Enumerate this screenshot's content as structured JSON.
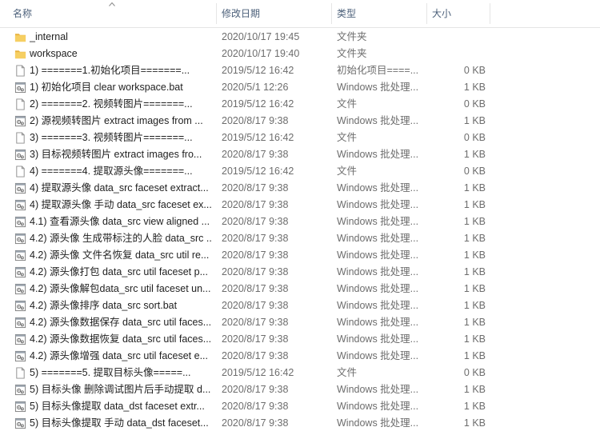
{
  "columns": {
    "name": "名称",
    "date": "修改日期",
    "type": "类型",
    "size": "大小"
  },
  "colors": {
    "header_text": "#4c607a",
    "folder": "#f0c55a",
    "muted_text": "#6d6d6d"
  },
  "rows": [
    {
      "icon": "folder-icon",
      "name": "_internal",
      "date": "2020/10/17 19:45",
      "type": "文件夹",
      "size": ""
    },
    {
      "icon": "folder-icon",
      "name": "workspace",
      "date": "2020/10/17 19:40",
      "type": "文件夹",
      "size": ""
    },
    {
      "icon": "file-icon",
      "name": "1) =======1.初始化项目=======...",
      "date": "2019/5/12 16:42",
      "type": "初始化项目====...",
      "size": "0 KB"
    },
    {
      "icon": "batch-file-icon",
      "name": "1) 初始化项目 clear workspace.bat",
      "date": "2020/5/1 12:26",
      "type": "Windows 批处理...",
      "size": "1 KB"
    },
    {
      "icon": "file-icon",
      "name": "2) =======2. 视频转图片=======...",
      "date": "2019/5/12 16:42",
      "type": "文件",
      "size": "0 KB"
    },
    {
      "icon": "batch-file-icon",
      "name": "2) 源视频转图片 extract images from ...",
      "date": "2020/8/17 9:38",
      "type": "Windows 批处理...",
      "size": "1 KB"
    },
    {
      "icon": "file-icon",
      "name": "3) =======3. 视频转图片=======...",
      "date": "2019/5/12 16:42",
      "type": "文件",
      "size": "0 KB"
    },
    {
      "icon": "batch-file-icon",
      "name": "3) 目标视频转图片 extract images fro...",
      "date": "2020/8/17 9:38",
      "type": "Windows 批处理...",
      "size": "1 KB"
    },
    {
      "icon": "file-icon",
      "name": "4) =======4. 提取源头像=======...",
      "date": "2019/5/12 16:42",
      "type": "文件",
      "size": "0 KB"
    },
    {
      "icon": "batch-file-icon",
      "name": "4) 提取源头像 data_src faceset extract...",
      "date": "2020/8/17 9:38",
      "type": "Windows 批处理...",
      "size": "1 KB"
    },
    {
      "icon": "batch-file-icon",
      "name": "4) 提取源头像 手动 data_src faceset ex...",
      "date": "2020/8/17 9:38",
      "type": "Windows 批处理...",
      "size": "1 KB"
    },
    {
      "icon": "batch-file-icon",
      "name": "4.1) 查看源头像 data_src view aligned ...",
      "date": "2020/8/17 9:38",
      "type": "Windows 批处理...",
      "size": "1 KB"
    },
    {
      "icon": "batch-file-icon",
      "name": "4.2) 源头像 生成带标注的人脸 data_src ...",
      "date": "2020/8/17 9:38",
      "type": "Windows 批处理...",
      "size": "1 KB"
    },
    {
      "icon": "batch-file-icon",
      "name": "4.2) 源头像 文件名恢复 data_src util re...",
      "date": "2020/8/17 9:38",
      "type": "Windows 批处理...",
      "size": "1 KB"
    },
    {
      "icon": "batch-file-icon",
      "name": "4.2) 源头像打包 data_src util faceset p...",
      "date": "2020/8/17 9:38",
      "type": "Windows 批处理...",
      "size": "1 KB"
    },
    {
      "icon": "batch-file-icon",
      "name": "4.2) 源头像解包data_src util faceset un...",
      "date": "2020/8/17 9:38",
      "type": "Windows 批处理...",
      "size": "1 KB"
    },
    {
      "icon": "batch-file-icon",
      "name": "4.2) 源头像排序 data_src sort.bat",
      "date": "2020/8/17 9:38",
      "type": "Windows 批处理...",
      "size": "1 KB"
    },
    {
      "icon": "batch-file-icon",
      "name": "4.2) 源头像数据保存 data_src util faces...",
      "date": "2020/8/17 9:38",
      "type": "Windows 批处理...",
      "size": "1 KB"
    },
    {
      "icon": "batch-file-icon",
      "name": "4.2) 源头像数据恢复 data_src util faces...",
      "date": "2020/8/17 9:38",
      "type": "Windows 批处理...",
      "size": "1 KB"
    },
    {
      "icon": "batch-file-icon",
      "name": "4.2) 源头像增强 data_src util faceset e...",
      "date": "2020/8/17 9:38",
      "type": "Windows 批处理...",
      "size": "1 KB"
    },
    {
      "icon": "file-icon",
      "name": "5) =======5. 提取目标头像=====...",
      "date": "2019/5/12 16:42",
      "type": "文件",
      "size": "0 KB"
    },
    {
      "icon": "batch-file-icon",
      "name": "5) 目标头像 删除调试图片后手动提取 d...",
      "date": "2020/8/17 9:38",
      "type": "Windows 批处理...",
      "size": "1 KB"
    },
    {
      "icon": "batch-file-icon",
      "name": "5) 目标头像提取 data_dst faceset extr...",
      "date": "2020/8/17 9:38",
      "type": "Windows 批处理...",
      "size": "1 KB"
    },
    {
      "icon": "batch-file-icon",
      "name": "5) 目标头像提取 手动  data_dst faceset...",
      "date": "2020/8/17 9:38",
      "type": "Windows 批处理...",
      "size": "1 KB"
    }
  ]
}
